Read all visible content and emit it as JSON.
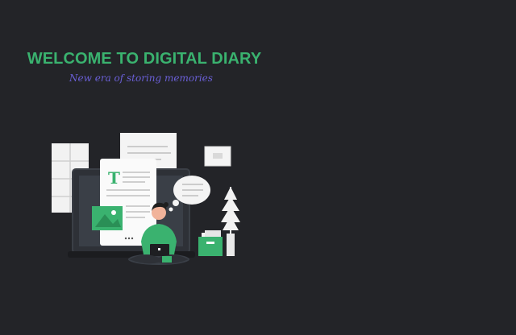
{
  "hero": {
    "title": "WELCOME TO DIGITAL DIARY",
    "subtitle": "New era of storing memories",
    "illustration_icon": "person-with-laptop-and-documents-illustration"
  },
  "colors": {
    "background": "#232428",
    "accent_green": "#3ab26f",
    "subtitle_purple": "#6a5fd6"
  }
}
